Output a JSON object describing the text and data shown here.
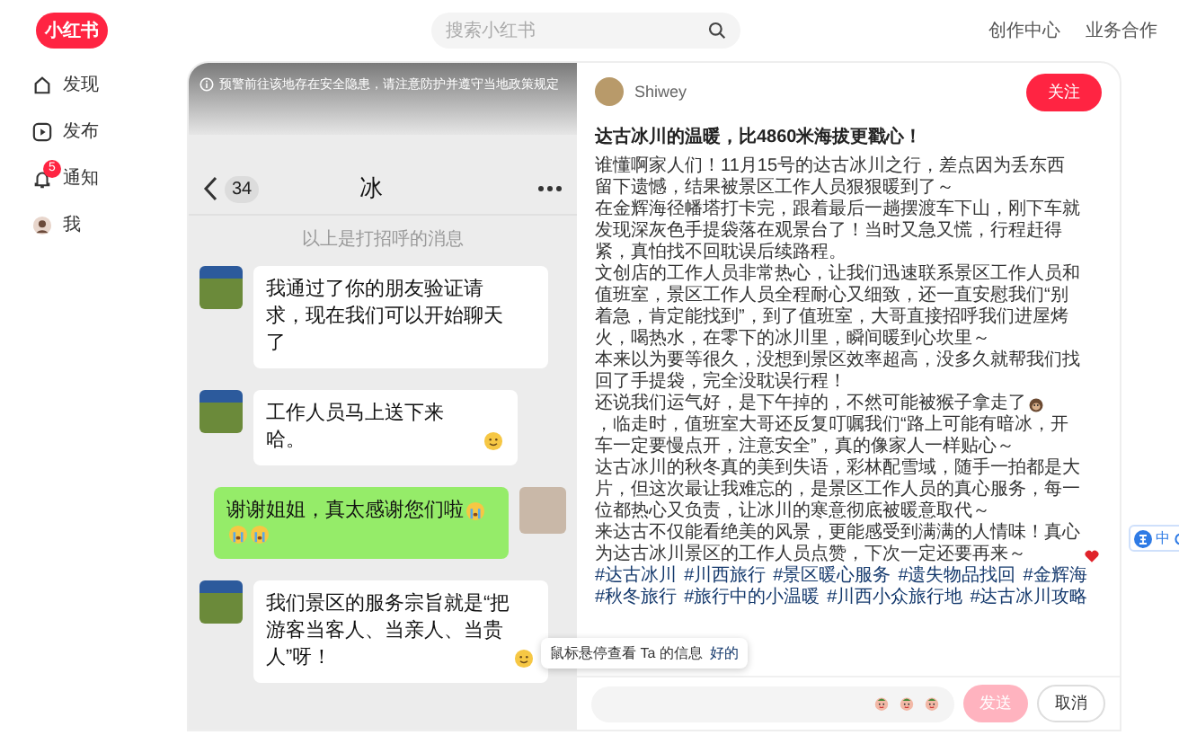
{
  "header": {
    "logo": "小红书",
    "search": {
      "placeholder": "搜索小红书"
    },
    "links": [
      "创作中心",
      "业务合作"
    ]
  },
  "sidebar": {
    "items": [
      {
        "label": "发现"
      },
      {
        "label": "发布"
      },
      {
        "label": "通知",
        "badge": "5"
      },
      {
        "label": "我"
      }
    ]
  },
  "image": {
    "warning": "预警前往该地存在安全隐患，请注意防护并遵守当地政策规定",
    "chat": {
      "unread": "34",
      "title": "冰",
      "notice": "以上是打招呼的消息",
      "messages": [
        {
          "kind": "incoming",
          "parts": [
            {
              "kind": "text",
              "text": "我通过了你的朋友验证请求，现在我们可以开始聊天了"
            }
          ]
        },
        {
          "kind": "incoming",
          "parts": [
            {
              "kind": "text",
              "text": "工作人员马上送下来哈。"
            },
            {
              "kind": "smile"
            }
          ]
        },
        {
          "kind": "outgoing",
          "parts": [
            {
              "kind": "text",
              "text": "谢谢姐姐，真太感谢您们啦"
            },
            {
              "kind": "cry"
            },
            {
              "kind": "cry"
            },
            {
              "kind": "cry"
            }
          ]
        },
        {
          "kind": "incoming",
          "parts": [
            {
              "kind": "text",
              "text": "我们景区的服务宗旨就是“把游客当客人、当亲人、当贵人”呀！"
            },
            {
              "kind": "smile"
            }
          ]
        }
      ]
    }
  },
  "post": {
    "author": "Shiwey",
    "follow": "关注",
    "title": "达古冰川的温暖，比4860米海拔更戳心！",
    "paragraphs": [
      {
        "parts": [
          {
            "kind": "text",
            "text": "谁懂啊家人们！11月15号的达古冰川之行，差点因为丢东西留下遗憾，结果被景区工作人员狠狠暖到了～"
          }
        ]
      },
      {
        "parts": [
          {
            "kind": "text",
            "text": "在金辉海径幡塔打卡完，跟着最后一趟摆渡车下山，刚下车就发现深灰色手提袋落在观景台了！当时又急又慌，行程赶得紧，真怕找不回耽误后续路程。"
          }
        ]
      },
      {
        "parts": [
          {
            "kind": "text",
            "text": "文创店的工作人员非常热心，让我们迅速联系景区工作人员和值班室，景区工作人员全程耐心又细致，还一直安慰我们“别着急，肯定能找到”，到了值班室，大哥直接招呼我们进屋烤火，喝热水，在零下的冰川里，瞬间暖到心坎里～"
          }
        ]
      },
      {
        "parts": [
          {
            "kind": "text",
            "text": "本来以为要等很久，没想到景区效率超高，没多久就帮我们找回了手提袋，完全没耽误行程！"
          }
        ]
      },
      {
        "parts": [
          {
            "kind": "text",
            "text": "还说我们运气好，是下午掉的，不然可能被猴子拿走了"
          },
          {
            "kind": "monkey"
          },
          {
            "kind": "text",
            "text": "，临走时，值班室大哥还反复叮嘱我们“路上可能有暗冰，开车一定要慢点开，注意安全”，真的像家人一样贴心～"
          }
        ]
      },
      {
        "parts": [
          {
            "kind": "text",
            "text": "达古冰川的秋冬真的美到失语，彩林配雪域，随手一拍都是大片，但这次最让我难忘的，是景区工作人员的真心服务，每一位都热心又负责，让冰川的寒意彻底被暖意取代～"
          }
        ]
      },
      {
        "parts": [
          {
            "kind": "text",
            "text": "来达古不仅能看绝美的风景，更能感受到满满的人情味！真心为达古冰川景区的工作人员点赞，下次一定还要再来～"
          },
          {
            "kind": "heart"
          }
        ]
      }
    ],
    "tags": [
      "#达古冰川",
      "#川西旅行",
      "#景区暖心服务",
      "#遗失物品找回",
      "#金辉海",
      "#秋冬旅行",
      "#旅行中的小温暖",
      "#川西小众旅行地",
      "#达古冰川攻略"
    ],
    "send": "发送",
    "cancel": "取消"
  },
  "tooltip": {
    "text": "鼠标悬停查看 Ta 的信息",
    "action": "好的"
  },
  "ime_toolbar": {
    "label": "中"
  }
}
